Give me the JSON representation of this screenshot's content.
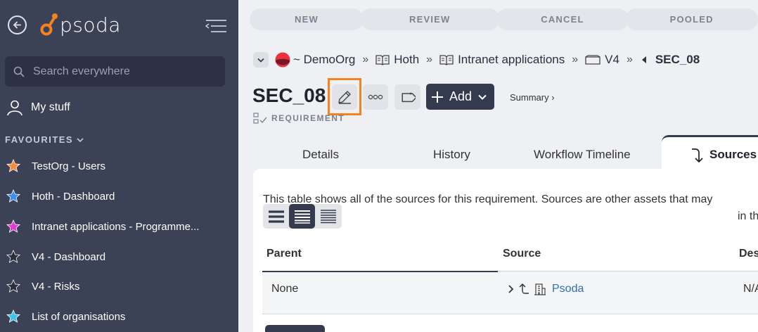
{
  "sidebar": {
    "logo_text": "psoda",
    "search_placeholder": "Search everywhere",
    "my_stuff": "My stuff",
    "favourites_label": "FAVOURITES",
    "favourites": [
      {
        "label": "TestOrg - Users",
        "star_color": "#f08a3c"
      },
      {
        "label": "Hoth - Dashboard",
        "star_color": "#3c8ee8"
      },
      {
        "label": "Intranet applications - Programme...",
        "star_color": "#e23ad6"
      },
      {
        "label": "V4 - Dashboard",
        "star_color": "#2b2f3b"
      },
      {
        "label": "V4 - Risks",
        "star_color": "#2b2f3b"
      },
      {
        "label": "List of organisations",
        "star_color": "#3fc3e8"
      }
    ]
  },
  "stages": [
    "NEW",
    "REVIEW",
    "CANCEL",
    "POOLED"
  ],
  "breadcrumb": {
    "org": "~ DemoOrg",
    "items": [
      "Hoth",
      "Intranet applications",
      "V4"
    ],
    "current": "SEC_08"
  },
  "header": {
    "title": "SEC_08",
    "add_label": "Add",
    "summary_link": "Summary ›",
    "type_label": "REQUIREMENT"
  },
  "tabs": {
    "details": "Details",
    "history": "History",
    "workflow": "Workflow Timeline",
    "sources": "Sources"
  },
  "panel": {
    "description": "This table shows all of the sources for this requirement. Sources are other assets that may",
    "description_cont": "in th",
    "columns": [
      "Parent",
      "Source",
      "Des"
    ],
    "rows": [
      {
        "parent": "None",
        "source": "Psoda",
        "desc": "N/A"
      }
    ]
  },
  "colors": {
    "sidebar_bg": "#3b4256",
    "accent": "#343b4e",
    "highlight": "#f58220",
    "link": "#2f6fb3"
  }
}
